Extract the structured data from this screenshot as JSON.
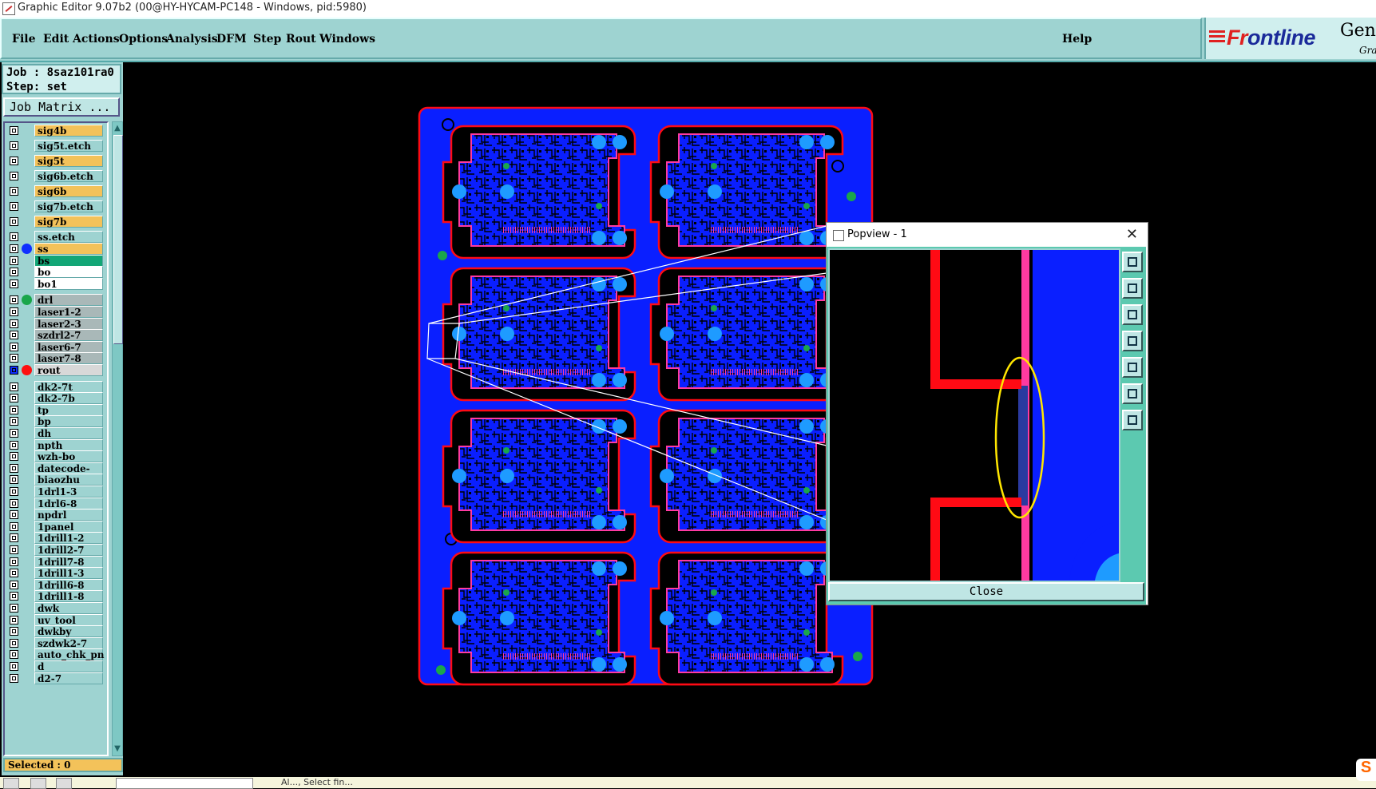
{
  "window": {
    "title": "Graphic Editor 9.07b2 (00@HY-HYCAM-PC148 - Windows, pid:5980)"
  },
  "menu": {
    "items": [
      "File",
      "Edit",
      "Actions",
      "Options",
      "Analysis",
      "DFM",
      "Step",
      "Rout",
      "Windows"
    ],
    "help": "Help"
  },
  "logo": {
    "brand_a": "Fr",
    "brand_b": "ntline",
    "brand_o": "o",
    "product": "Gen",
    "sub": "Gra"
  },
  "job": {
    "job_line": "Job : 8saz101ra0",
    "step_line": "Step: set",
    "matrix_button": "Job Matrix ..."
  },
  "layers": [
    {
      "name": "sig4b",
      "bg": "#f3c25a"
    },
    {
      "name": "sig5t.etch",
      "bg": "#9ed3d1"
    },
    {
      "name": "sig5t",
      "bg": "#f3c25a"
    },
    {
      "name": "sig6b.etch",
      "bg": "#9ed3d1"
    },
    {
      "name": "sig6b",
      "bg": "#f3c25a"
    },
    {
      "name": "sig7b.etch",
      "bg": "#9ed3d1"
    },
    {
      "name": "sig7b",
      "bg": "#f3c25a"
    },
    {
      "name": "ss.etch",
      "bg": "#9ed3d1"
    },
    {
      "name": "ss",
      "bg": "#f3c25a",
      "dot": "#1030ff"
    },
    {
      "name": "bs",
      "bg": "#13a676"
    },
    {
      "name": "bo",
      "bg": "#ffffff"
    },
    {
      "name": "bo1",
      "bg": "#ffffff"
    },
    {
      "name": "drl",
      "bg": "#a9b8b8",
      "dot": "#1aa64a"
    },
    {
      "name": "laser1-2",
      "bg": "#a9b8b8"
    },
    {
      "name": "laser2-3",
      "bg": "#a9b8b8"
    },
    {
      "name": "szdrl2-7",
      "bg": "#a9b8b8"
    },
    {
      "name": "laser6-7",
      "bg": "#a9b8b8"
    },
    {
      "name": "laser7-8",
      "bg": "#a9b8b8"
    },
    {
      "name": "rout",
      "bg": "#d8d8d8",
      "dot": "#ff1010",
      "active": true
    },
    {
      "name": "dk2-7t",
      "bg": "#9ed3d1"
    },
    {
      "name": "dk2-7b",
      "bg": "#9ed3d1"
    },
    {
      "name": "tp",
      "bg": "#9ed3d1"
    },
    {
      "name": "bp",
      "bg": "#9ed3d1"
    },
    {
      "name": "dh",
      "bg": "#9ed3d1"
    },
    {
      "name": "npth",
      "bg": "#9ed3d1"
    },
    {
      "name": "wzh-bo",
      "bg": "#9ed3d1"
    },
    {
      "name": "datecode-bo",
      "bg": "#9ed3d1"
    },
    {
      "name": "biaozhu",
      "bg": "#9ed3d1"
    },
    {
      "name": "1drl1-3",
      "bg": "#9ed3d1"
    },
    {
      "name": "1drl6-8",
      "bg": "#9ed3d1"
    },
    {
      "name": "npdrl",
      "bg": "#9ed3d1"
    },
    {
      "name": "1panel",
      "bg": "#9ed3d1"
    },
    {
      "name": "1drill1-2",
      "bg": "#9ed3d1"
    },
    {
      "name": "1drill2-7",
      "bg": "#9ed3d1"
    },
    {
      "name": "1drill7-8",
      "bg": "#9ed3d1"
    },
    {
      "name": "1drill1-3",
      "bg": "#9ed3d1"
    },
    {
      "name": "1drill6-8",
      "bg": "#9ed3d1"
    },
    {
      "name": "1drill1-8",
      "bg": "#9ed3d1"
    },
    {
      "name": "dwk",
      "bg": "#9ed3d1"
    },
    {
      "name": "uv_tool",
      "bg": "#9ed3d1"
    },
    {
      "name": "dwkby",
      "bg": "#9ed3d1"
    },
    {
      "name": "szdwk2-7",
      "bg": "#9ed3d1"
    },
    {
      "name": "auto_chk_pn",
      "bg": "#9ed3d1"
    },
    {
      "name": "d",
      "bg": "#9ed3d1"
    },
    {
      "name": "d2-7",
      "bg": "#9ed3d1"
    }
  ],
  "selected": "Selected : 0",
  "status": {
    "message": "Al..., Select fin..."
  },
  "popview": {
    "title": "Popview - 1",
    "close_x": "✕",
    "close_button": "Close",
    "tools": [
      "zoom-window-icon",
      "move-up-icon",
      "move-down-icon",
      "move-left-icon",
      "move-right-icon",
      "zoom-fit-icon",
      "center-icon"
    ]
  },
  "colors": {
    "board_blue": "#0a1fff",
    "pad_light": "#1e9bff",
    "rout_red": "#ff0a14",
    "pink": "#ff3aa0",
    "teal_ui": "#9ed3d1",
    "highlight_yellow": "#ffe600"
  }
}
